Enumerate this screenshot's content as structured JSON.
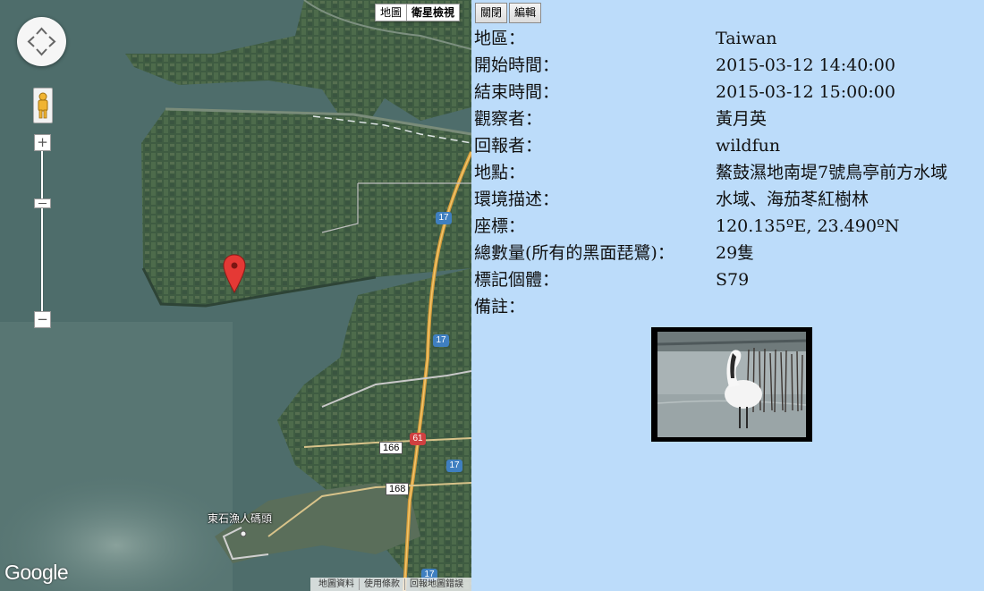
{
  "map": {
    "type_tabs": [
      "地圖",
      "衛星檢視"
    ],
    "road_shields": {
      "r17a": "17",
      "r17b": "17",
      "r17c": "17",
      "r17d": "17",
      "r61": "61",
      "r166": "166",
      "r168": "168"
    },
    "place_label": "東石漁人碼頭",
    "logo": "Google",
    "footer": [
      "地圖資料",
      "使用條款",
      "回報地圖錯誤"
    ],
    "zoom_in": "+",
    "zoom_out": "−"
  },
  "panel": {
    "buttons": {
      "close": "關閉",
      "edit": "編輯"
    },
    "rows": [
      {
        "key": "地區：",
        "value": "Taiwan"
      },
      {
        "key": "開始時間：",
        "value": "2015-03-12 14:40:00"
      },
      {
        "key": "結束時間：",
        "value": "2015-03-12 15:00:00"
      },
      {
        "key": "觀察者：",
        "value": "黃月英"
      },
      {
        "key": "回報者：",
        "value": "wildfun"
      },
      {
        "key": "地點：",
        "value": "鰲鼓濕地南堤7號鳥亭前方水域"
      },
      {
        "key": "環境描述：",
        "value": "水域、海茄苳紅樹林"
      },
      {
        "key": "座標：",
        "value": "120.135ºE, 23.490ºN"
      },
      {
        "key": "總數量(所有的黑面琵鷺)：",
        "value": "29隻"
      },
      {
        "key": "標記個體：",
        "value": "S79"
      },
      {
        "key": "備註：",
        "value": ""
      }
    ]
  },
  "colors": {
    "panel_bg": "#bcdcfa",
    "marker": "#e53935",
    "road_shield": "#3f7fc0"
  }
}
